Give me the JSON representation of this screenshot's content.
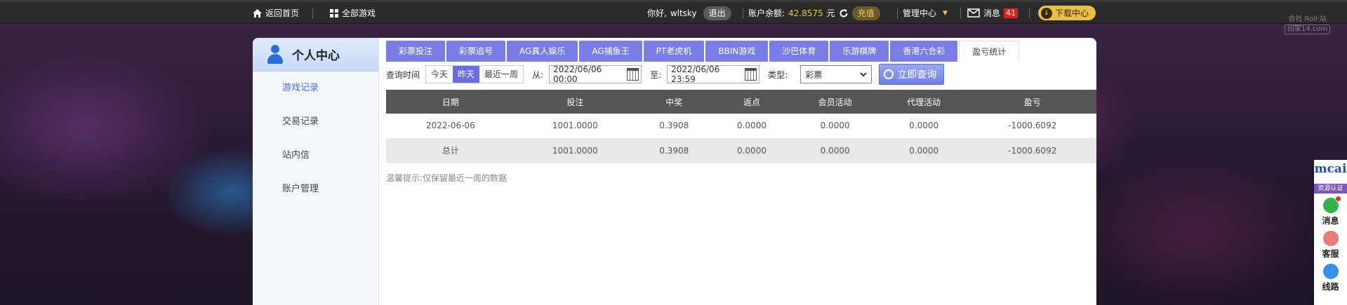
{
  "topbar": {
    "home_label": "返回首页",
    "all_games_label": "全部游戏",
    "greeting": "你好,",
    "username": "wltsky",
    "logout_label": "退出",
    "balance_label": "账户余额:",
    "balance_value": "42.8575",
    "balance_unit": "元",
    "recharge_label": "充值",
    "manage_label": "管理中心",
    "messages_label": "消息",
    "messages_count": "41",
    "download_label": "下载中心"
  },
  "watermark": {
    "line1": "合社 Roll·站",
    "line2": "回家14.com"
  },
  "sidebar": {
    "title": "个人中心",
    "items": [
      {
        "label": "游戏记录",
        "active": true
      },
      {
        "label": "交易记录",
        "active": false
      },
      {
        "label": "站内信",
        "active": false
      },
      {
        "label": "账户管理",
        "active": false
      }
    ]
  },
  "tabs": [
    {
      "label": "彩票投注"
    },
    {
      "label": "彩票追号"
    },
    {
      "label": "AG真人娱乐"
    },
    {
      "label": "AG捕鱼王"
    },
    {
      "label": "PT老虎机"
    },
    {
      "label": "BBIN游戏"
    },
    {
      "label": "沙巴体育"
    },
    {
      "label": "乐游棋牌"
    },
    {
      "label": "香港六合彩"
    },
    {
      "label": "盈亏统计",
      "active": true
    }
  ],
  "filter": {
    "query_time_label": "查询时间",
    "ranges": [
      "今天",
      "昨天",
      "最近一周"
    ],
    "selected_range": "昨天",
    "from_label": "从:",
    "from_value": "2022/06/06 00:00",
    "to_label": "至:",
    "to_value": "2022/06/06 23:59",
    "type_label": "类型:",
    "type_value": "彩票",
    "search_label": "立即查询"
  },
  "table": {
    "columns": [
      "日期",
      "投注",
      "中奖",
      "返点",
      "会员活动",
      "代理活动",
      "盈亏"
    ],
    "rows": [
      [
        "2022-06-06",
        "1001.0000",
        "0.3908",
        "0.0000",
        "0.0000",
        "0.0000",
        "-1000.6092"
      ],
      [
        "总计",
        "1001.0000",
        "0.3908",
        "0.0000",
        "0.0000",
        "0.0000",
        "-1000.6092"
      ]
    ]
  },
  "tip": "温馨提示:仅保留最近一周的数据",
  "right_float": {
    "logo": "mcai",
    "tag": "资源认证",
    "items": [
      {
        "label": "消息",
        "color": "#35b24a"
      },
      {
        "label": "客服",
        "color": "#e87a7a"
      },
      {
        "label": "线路",
        "color": "#3a8ee6"
      }
    ]
  },
  "colors": {
    "tab": "#7b7de6",
    "accent": "#6c6ee0",
    "gold": "#e8c048"
  }
}
